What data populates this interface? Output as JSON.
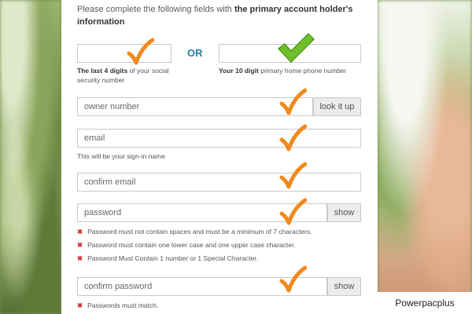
{
  "intro": {
    "prefix": "Please complete the following fields with ",
    "bold": "the primary account holder's information"
  },
  "ssn": {
    "label_bold": "The last 4 digits",
    "label_rest": " of your social security number"
  },
  "or_label": "OR",
  "phone": {
    "label_bold": "Your 10 digit",
    "label_rest": " primary home phone number"
  },
  "owner": {
    "placeholder": "owner number",
    "button": "look it up"
  },
  "email": {
    "placeholder": "email",
    "help": "This will be your sign-in name"
  },
  "confirm_email": {
    "placeholder": "confirm email"
  },
  "password": {
    "placeholder": "password",
    "button": "show",
    "errors": [
      "Password must not contain spaces and must be a minimum of 7 characters.",
      "Password must contain one lower case and one upper case character.",
      "Password Must Contain 1 number or 1 Special Character."
    ]
  },
  "confirm_password": {
    "placeholder": "confirm password",
    "button": "show",
    "errors": [
      "Passwords must match."
    ]
  },
  "caption": "Powerpacplus",
  "colors": {
    "orange_check": "#f08a1c",
    "green_check": "#6fbf2a",
    "or_blue": "#1f7fa8",
    "error_red": "#d0312d"
  }
}
